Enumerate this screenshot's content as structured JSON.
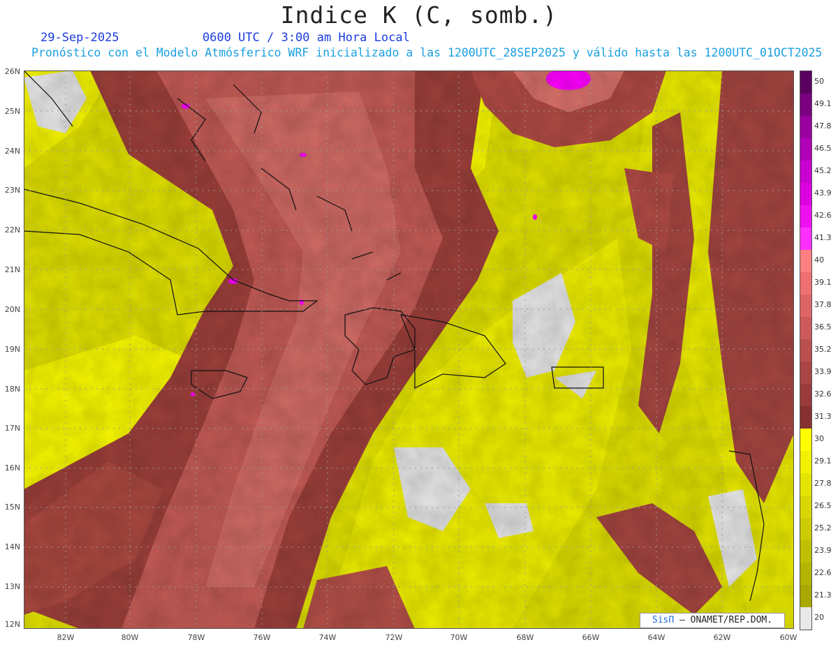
{
  "title": "Indice K (C, somb.)",
  "date": "29-Sep-2025",
  "valid_time": "0600 UTC / 3:00 am Hora Local",
  "description": "Pronóstico con el Modelo Atmósferico WRF inicializado a las 1200UTC_28SEP2025 y válido hasta las  1200UTC_01OCT2025",
  "credit": {
    "brand": "SisΠ",
    "text": "– ONAMET/REP.DOM."
  },
  "lat_labels": [
    "26N",
    "25N",
    "24N",
    "23N",
    "22N",
    "21N",
    "20N",
    "19N",
    "18N",
    "17N",
    "16N",
    "15N",
    "14N",
    "13N",
    "12N"
  ],
  "lon_labels": [
    "82W",
    "80W",
    "78W",
    "76W",
    "74W",
    "72W",
    "70W",
    "68W",
    "66W",
    "64W",
    "62W",
    "60W"
  ],
  "colorbar": {
    "labels": [
      "50",
      "49.1",
      "47.8",
      "46.5",
      "45.2",
      "43.9",
      "42.6",
      "41.3",
      "40",
      "39.1",
      "37.8",
      "36.5",
      "35.2",
      "33.9",
      "32.6",
      "31.3",
      "30",
      "29.1",
      "27.8",
      "26.5",
      "25.2",
      "23.9",
      "22.6",
      "21.3",
      "20"
    ],
    "colors": [
      "#5a0060",
      "#7a0080",
      "#9a00a0",
      "#b000b8",
      "#c800d0",
      "#dc00e0",
      "#ee10f0",
      "#ff30ff",
      "#ff8080",
      "#ee7070",
      "#de6565",
      "#cc5a5a",
      "#bb5050",
      "#a94545",
      "#993b3b",
      "#873030",
      "#ffff00",
      "#f0f000",
      "#e4e400",
      "#d8d800",
      "#cccc00",
      "#c0c000",
      "#b4b400",
      "#a8a800",
      "#e8e8e8"
    ]
  }
}
